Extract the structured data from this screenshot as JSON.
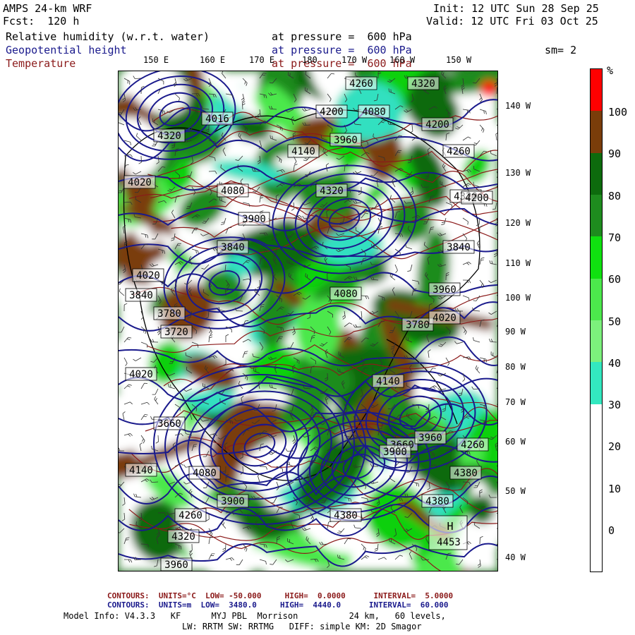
{
  "header": {
    "model": "AMPS 24-km WRF",
    "forecast": "Fcst:  120 h",
    "init": "Init: 12 UTC Sun 28 Sep 25",
    "valid": "Valid: 12 UTC Fri 03 Oct 25"
  },
  "fields": [
    {
      "name": "Relative humidity (w.r.t. water)",
      "level": "at pressure =  600 hPa",
      "color": "#000000"
    },
    {
      "name": "Geopotential height",
      "level": "at pressure =  600 hPa",
      "color": "#1a1a8c"
    },
    {
      "name": "Temperature",
      "level": "at pressure =  600 hPa",
      "color": "#8b1a1a"
    }
  ],
  "smoothing": "sm= 2",
  "lon_labels_top": [
    "150 E",
    "160 E",
    "170 E",
    "180",
    "170 W",
    "160 W",
    "150 W"
  ],
  "lat_labels_right": [
    "140 W",
    "130 W",
    "120 W",
    "110 W",
    "100 W",
    "90 W",
    "80 W",
    "70 W",
    "60 W",
    "50 W",
    "40 W"
  ],
  "colorbar": {
    "unit": "%",
    "levels": [
      "100",
      "90",
      "80",
      "70",
      "60",
      "50",
      "40",
      "30",
      "20",
      "10",
      "0"
    ],
    "colors": [
      "#ff0000",
      "#7a3d0a",
      "#0d6b0d",
      "#1e8c1e",
      "#10e010",
      "#4ce84c",
      "#7cf07c",
      "#33e8c0",
      "#ffffff",
      "#ffffff",
      "#ffffff",
      "#ffffff"
    ]
  },
  "contour_labels": [
    "4260",
    "4320",
    "4200",
    "4080",
    "4016",
    "4320",
    "4140",
    "4260",
    "3960",
    "4200",
    "4320",
    "4200",
    "4020",
    "4080",
    "3900",
    "3840",
    "4020",
    "3840",
    "3780",
    "4080",
    "3720",
    "3960",
    "3660",
    "4020",
    "3780",
    "3840",
    "3660",
    "4140",
    "3960",
    "4020",
    "3900",
    "4260",
    "4140",
    "4080",
    "3900",
    "4380",
    "4260",
    "4320",
    "3960",
    "4320",
    "4380",
    "4380"
  ],
  "highs": [
    {
      "label": "H",
      "value": "4453"
    }
  ],
  "footer": {
    "temp_contours": "CONTOURS:  UNITS=°C  LOW= -50.000     HIGH=  0.0000      INTERVAL=  5.0000",
    "height_contours": "CONTOURS:  UNITS=m  LOW=  3480.0     HIGH=  4440.0      INTERVAL=  60.000",
    "model_info": "Model Info: V4.3.3   KF      MYJ PBL  Morrison          24 km,   60 levels,",
    "model_info2": "LW: RRTM SW: RRTMG   DIFF: simple KM: 2D Smagor"
  }
}
